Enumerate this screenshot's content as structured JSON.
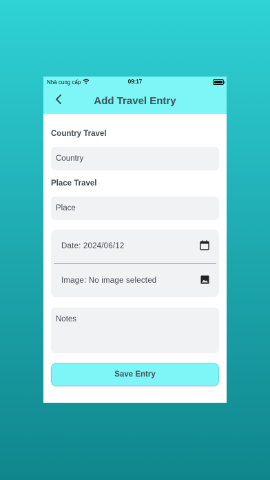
{
  "status_bar": {
    "carrier": "Nhà cung cấp",
    "time": "09:17"
  },
  "app_bar": {
    "title": "Add Travel Entry"
  },
  "form": {
    "country_label": "Country Travel",
    "country_placeholder": "Country",
    "place_label": "Place Travel",
    "place_placeholder": "Place",
    "date_text": "Date: 2024/06/12",
    "image_text": "Image: No image selected",
    "notes_placeholder": "Notes",
    "save_label": "Save Entry"
  },
  "icons": {
    "back": "chevron-left-icon",
    "calendar": "calendar-icon",
    "image": "image-icon",
    "wifi": "wifi-icon",
    "battery": "battery-icon"
  },
  "colors": {
    "accent": "#7ef6f7",
    "title_text": "#3d4e5a",
    "field_bg": "#f1f2f4",
    "background_top": "#2fd3d6",
    "background_bottom": "#0f868c"
  }
}
